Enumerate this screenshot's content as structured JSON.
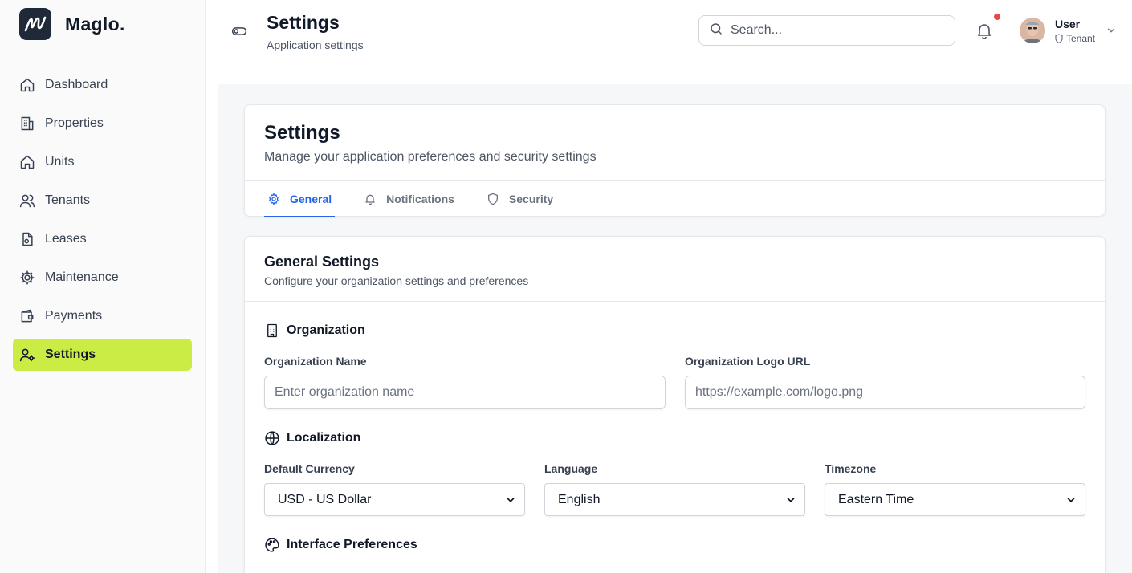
{
  "brand": {
    "name": "Maglo."
  },
  "sidebar": {
    "items": [
      {
        "label": "Dashboard",
        "icon": "home-icon"
      },
      {
        "label": "Properties",
        "icon": "building-icon"
      },
      {
        "label": "Units",
        "icon": "home-icon"
      },
      {
        "label": "Tenants",
        "icon": "users-icon"
      },
      {
        "label": "Leases",
        "icon": "file-icon"
      },
      {
        "label": "Maintenance",
        "icon": "gear-icon"
      },
      {
        "label": "Payments",
        "icon": "wallet-icon"
      },
      {
        "label": "Settings",
        "icon": "user-gear-icon",
        "active": true
      }
    ]
  },
  "header": {
    "title": "Settings",
    "subtitle": "Application settings",
    "search_placeholder": "Search...",
    "user": {
      "name": "User",
      "role": "Tenant"
    }
  },
  "settings_card": {
    "title": "Settings",
    "description": "Manage your application preferences and security settings",
    "tabs": [
      {
        "label": "General",
        "active": true
      },
      {
        "label": "Notifications"
      },
      {
        "label": "Security"
      }
    ]
  },
  "general": {
    "title": "General Settings",
    "description": "Configure your organization settings and preferences",
    "organization": {
      "heading": "Organization",
      "name_label": "Organization Name",
      "name_placeholder": "Enter organization name",
      "logo_label": "Organization Logo URL",
      "logo_placeholder": "https://example.com/logo.png"
    },
    "localization": {
      "heading": "Localization",
      "currency_label": "Default Currency",
      "currency_value": "USD - US Dollar",
      "language_label": "Language",
      "language_value": "English",
      "timezone_label": "Timezone",
      "timezone_value": "Eastern Time"
    },
    "interface": {
      "heading": "Interface Preferences"
    }
  },
  "colors": {
    "accent": "#cbec45",
    "tab_active": "#2563eb",
    "notification_dot": "#ef4444"
  }
}
